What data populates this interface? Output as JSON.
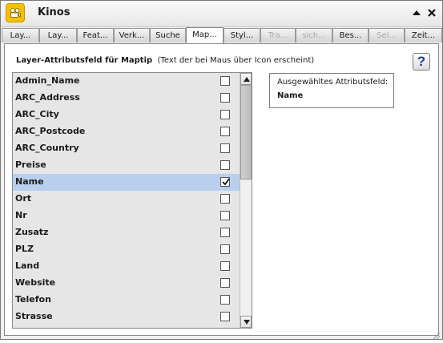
{
  "window": {
    "title": "Kinos",
    "icon": "film-camera-icon",
    "minimize_icon": "caret-up-icon",
    "close_icon": "close-icon"
  },
  "tabs": [
    {
      "label": "Lay...",
      "active": false,
      "disabled": false
    },
    {
      "label": "Lay...",
      "active": false,
      "disabled": false
    },
    {
      "label": "Feat...",
      "active": false,
      "disabled": false
    },
    {
      "label": "Verk...",
      "active": false,
      "disabled": false
    },
    {
      "label": "Suche",
      "active": false,
      "disabled": false
    },
    {
      "label": "Map...",
      "active": true,
      "disabled": false
    },
    {
      "label": "Styl...",
      "active": false,
      "disabled": false
    },
    {
      "label": "Tra...",
      "active": false,
      "disabled": true
    },
    {
      "label": "sich...",
      "active": false,
      "disabled": true
    },
    {
      "label": "Bes...",
      "active": false,
      "disabled": false
    },
    {
      "label": "Sel...",
      "active": false,
      "disabled": true
    },
    {
      "label": "Zeit...",
      "active": false,
      "disabled": false
    }
  ],
  "panel": {
    "heading_bold": "Layer-Attributsfeld für Maptip",
    "heading_note": "(Text der bei Maus über Icon erscheint)",
    "help_label": "?"
  },
  "fields": [
    {
      "name": "Admin_Name",
      "checked": false
    },
    {
      "name": "ARC_Address",
      "checked": false
    },
    {
      "name": "ARC_City",
      "checked": false
    },
    {
      "name": "ARC_Postcode",
      "checked": false
    },
    {
      "name": "ARC_Country",
      "checked": false
    },
    {
      "name": "Preise",
      "checked": false
    },
    {
      "name": "Name",
      "checked": true
    },
    {
      "name": "Ort",
      "checked": false
    },
    {
      "name": "Nr",
      "checked": false
    },
    {
      "name": "Zusatz",
      "checked": false
    },
    {
      "name": "PLZ",
      "checked": false
    },
    {
      "name": "Land",
      "checked": false
    },
    {
      "name": "Website",
      "checked": false
    },
    {
      "name": "Telefon",
      "checked": false
    },
    {
      "name": "Strasse",
      "checked": false
    }
  ],
  "selected_info": {
    "label": "Ausgewähltes Attributsfeld:",
    "value": "Name"
  },
  "colors": {
    "selected_row": "#b8d0ee",
    "app_icon": "#f5c000"
  }
}
